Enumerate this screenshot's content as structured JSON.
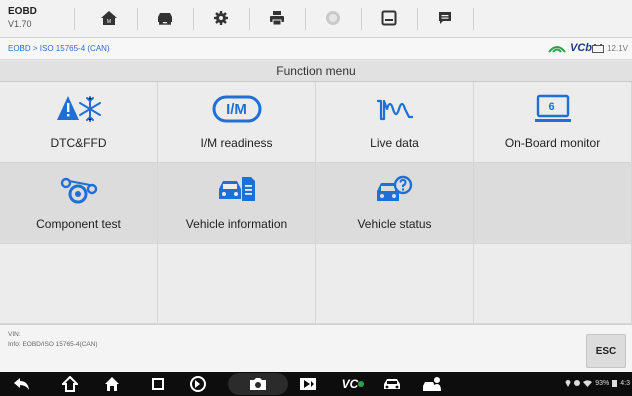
{
  "app": {
    "name": "EOBD",
    "version": "V1.70"
  },
  "toolbar": {
    "items": [
      "home",
      "vehicle-swap",
      "settings",
      "print",
      "help",
      "save",
      "data-manager"
    ]
  },
  "breadcrumb": {
    "text": "EOBD > ISO 15765-4 (CAN)"
  },
  "vci": {
    "label": "VCb",
    "voltage": "12.1V"
  },
  "menu": {
    "title": "Function menu",
    "items": [
      {
        "label": "DTC&FFD",
        "icon": "dtc-snowflake-icon"
      },
      {
        "label": "I/M readiness",
        "icon": "im-readiness-icon",
        "icon_text": "I/M"
      },
      {
        "label": "Live data",
        "icon": "live-data-wave-icon"
      },
      {
        "label": "On-Board monitor",
        "icon": "onboard-monitor-icon",
        "icon_text": "6"
      },
      {
        "label": "Component test",
        "icon": "component-test-icon"
      },
      {
        "label": "Vehicle information",
        "icon": "vehicle-info-icon"
      },
      {
        "label": "Vehicle status",
        "icon": "vehicle-status-icon"
      }
    ]
  },
  "info": {
    "vin": "VIN:",
    "line": "Info: EOBD/ISO 15765-4(CAN)"
  },
  "esc": {
    "label": "ESC"
  },
  "nav": {
    "vci_text": "VC",
    "status": "93%",
    "time": "4:3"
  },
  "colors": {
    "accent": "#1e6fd6",
    "navbar": "#0d0d0d",
    "toolbar_icon": "#333333"
  }
}
